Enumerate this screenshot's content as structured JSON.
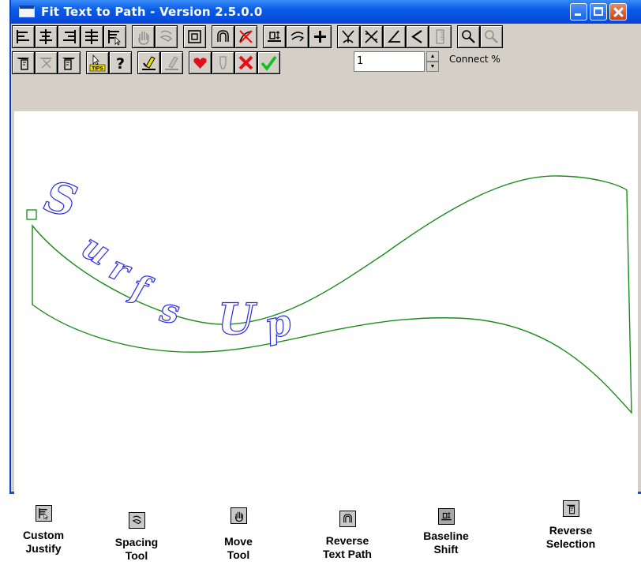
{
  "window": {
    "title": "Fit Text to Path - Version 2.5.0.0"
  },
  "toolbar": {
    "row1": [
      "custom-justify-left",
      "justify-center",
      "justify-right",
      "justify-full",
      "custom-justify",
      "move-tool",
      "spacing-tool",
      "frame-tool",
      "reverse-text-path",
      "no-path",
      "baseline-shift",
      "rotate-chars",
      "add-point",
      "node-tool",
      "cross-tool",
      "angle-tool",
      "less-tool",
      "ruler-tool",
      "zoom-tool",
      "zoom-tool-2"
    ],
    "row2": [
      "reverse-selection-1",
      "reverse-selection-2",
      "reverse-selection-3",
      "tips-button",
      "help-button",
      "highlight-tool",
      "pen-tool",
      "heart-button",
      "eraser-tool",
      "cancel-button",
      "ok-button"
    ],
    "connect_value": "1",
    "connect_label": "Connect %"
  },
  "canvas": {
    "text_on_path": "Surfs Up",
    "path_color": "#1a8c1a",
    "text_color": "#2a2ae0"
  },
  "legend": [
    {
      "icon": "custom-justify-icon",
      "label": "Custom\nJustify"
    },
    {
      "icon": "spacing-tool-icon",
      "label": "Spacing\nTool"
    },
    {
      "icon": "move-tool-icon",
      "label": "Move\nTool"
    },
    {
      "icon": "reverse-text-path-icon",
      "label": "Reverse\nText Path"
    },
    {
      "icon": "baseline-shift-icon",
      "label": "Baseline\nShift"
    },
    {
      "icon": "reverse-selection-icon",
      "label": "Reverse\nSelection"
    }
  ]
}
